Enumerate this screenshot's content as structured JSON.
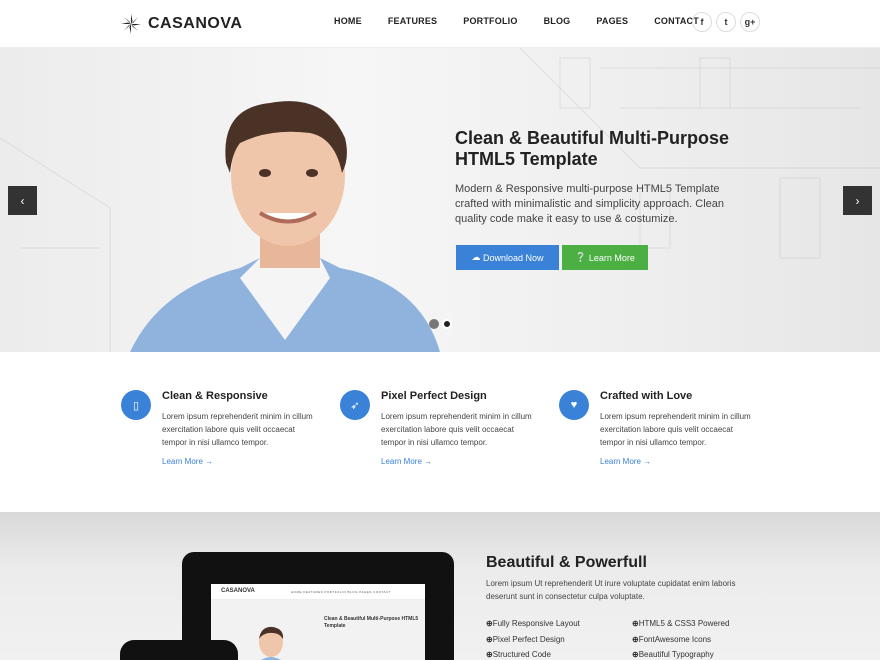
{
  "header": {
    "logo_text": "CASANOVA",
    "nav": [
      "HOME",
      "FEATURES",
      "PORTFOLIO",
      "BLOG",
      "PAGES",
      "CONTACT"
    ],
    "social": [
      {
        "icon": "facebook-icon",
        "glyph": "f"
      },
      {
        "icon": "twitter-icon",
        "glyph": "t"
      },
      {
        "icon": "google-plus-icon",
        "glyph": "g+"
      }
    ]
  },
  "hero": {
    "title": "Clean & Beautiful Multi-Purpose HTML5 Template",
    "text": "Modern & Responsive multi-purpose HTML5 Template crafted with minimalistic and simplicity approach. Clean quality code make it easy to use & costumize.",
    "download_label": "Download Now",
    "learn_label": "Learn More",
    "prev_arrow": "‹",
    "next_arrow": "›"
  },
  "features": [
    {
      "title": "Clean & Responsive",
      "text": "Lorem ipsum reprehenderit minim in cillum exercitation labore quis velit occaecat tempor in nisi ullamco tempor.",
      "link": "Learn More →",
      "icon": "mobile-icon",
      "glyph": "▯"
    },
    {
      "title": "Pixel Perfect Design",
      "text": "Lorem ipsum reprehenderit minim in cillum exercitation labore quis velit occaecat tempor in nisi ullamco tempor.",
      "link": "Learn More →",
      "icon": "rocket-icon",
      "glyph": "➶"
    },
    {
      "title": "Crafted with Love",
      "text": "Lorem ipsum reprehenderit minim in cillum exercitation labore quis velit occaecat tempor in nisi ullamco tempor.",
      "link": "Learn More →",
      "icon": "heart-icon",
      "glyph": "♥"
    }
  ],
  "showcase": {
    "title": "Beautiful & Powerfull",
    "text": "Lorem ipsum Ut reprehenderit Ut irure voluptate cupidatat enim laboris deserunt sunt in consectetur culpa voluptate.",
    "list_left": [
      "Fully Responsive Layout",
      "Pixel Perfect Design",
      "Structured Code"
    ],
    "list_right": [
      "HTML5 & CSS3 Powered",
      "FontAwesome Icons",
      "Beautiful Typography"
    ],
    "mini_logo": "CASANOVA",
    "mini_links": "HOME  FEATURES  PORTFOLIO  BLOG  PAGES  CONTACT",
    "mini_title": "Clean & Beautiful Multi-Purpose HTML5 Template"
  },
  "colors": {
    "accent": "#3a82d8",
    "green": "#4caf43",
    "dark": "#333333"
  }
}
